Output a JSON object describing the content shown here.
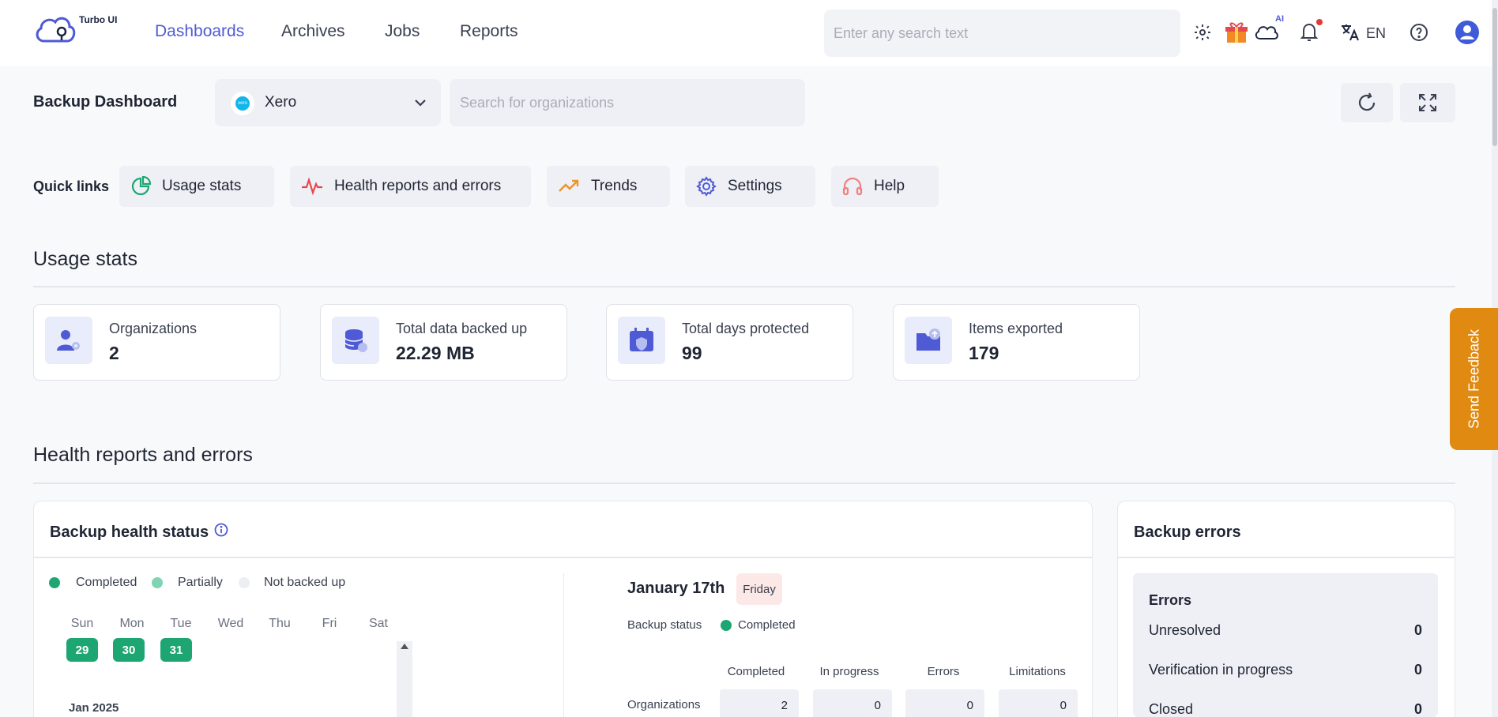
{
  "brand": {
    "name": "Turbo UI"
  },
  "nav": {
    "items": [
      "Dashboards",
      "Archives",
      "Jobs",
      "Reports"
    ],
    "active": "Dashboards"
  },
  "search": {
    "placeholder": "Enter any search text"
  },
  "header_icons": {
    "ai_label": "AI",
    "language": "EN"
  },
  "page": {
    "title": "Backup Dashboard",
    "app_select": {
      "value": "Xero",
      "logo_text": "xero"
    },
    "org_search_placeholder": "Search for organizations"
  },
  "quick_links": {
    "label": "Quick links",
    "items": [
      {
        "label": "Usage stats",
        "icon": "pie-chart-icon",
        "color": "#1ea672"
      },
      {
        "label": "Health reports and errors",
        "icon": "pulse-icon",
        "color": "#e5484d"
      },
      {
        "label": "Trends",
        "icon": "trending-up-icon",
        "color": "#f0932b"
      },
      {
        "label": "Settings",
        "icon": "gear-icon",
        "color": "#4f5bd5"
      },
      {
        "label": "Help",
        "icon": "headset-icon",
        "color": "#f08080"
      }
    ]
  },
  "usage_stats": {
    "title": "Usage stats",
    "cards": [
      {
        "label": "Organizations",
        "value": "2",
        "icon": "users-gear-icon"
      },
      {
        "label": "Total data backed up",
        "value": "22.29 MB",
        "icon": "database-icon"
      },
      {
        "label": "Total days protected",
        "value": "99",
        "icon": "calendar-shield-icon"
      },
      {
        "label": "Items exported",
        "value": "179",
        "icon": "folder-export-icon"
      }
    ]
  },
  "feedback": {
    "label": "Send Feedback"
  },
  "health": {
    "section_title": "Health reports and errors",
    "panel_title": "Backup health status",
    "legend": [
      {
        "label": "Completed",
        "color": "#1ea672"
      },
      {
        "label": "Partially",
        "color": "#7fd4b3"
      },
      {
        "label": "Not backed up",
        "color": "#eceef2"
      }
    ],
    "weekdays": [
      "Sun",
      "Mon",
      "Tue",
      "Wed",
      "Thu",
      "Fri",
      "Sat"
    ],
    "days": [
      "29",
      "30",
      "31"
    ],
    "month_label": "Jan 2025",
    "detail": {
      "date": "January 17th",
      "weekday": "Friday",
      "status_label": "Backup status",
      "status_value": "Completed",
      "columns": [
        "Completed",
        "In progress",
        "Errors",
        "Limitations"
      ],
      "row_label": "Organizations",
      "row_values": [
        "2",
        "0",
        "0",
        "0"
      ]
    }
  },
  "errors": {
    "panel_title": "Backup errors",
    "box_title": "Errors",
    "rows": [
      {
        "label": "Unresolved",
        "value": "0"
      },
      {
        "label": "Verification in progress",
        "value": "0"
      },
      {
        "label": "Closed",
        "value": "0"
      }
    ]
  }
}
